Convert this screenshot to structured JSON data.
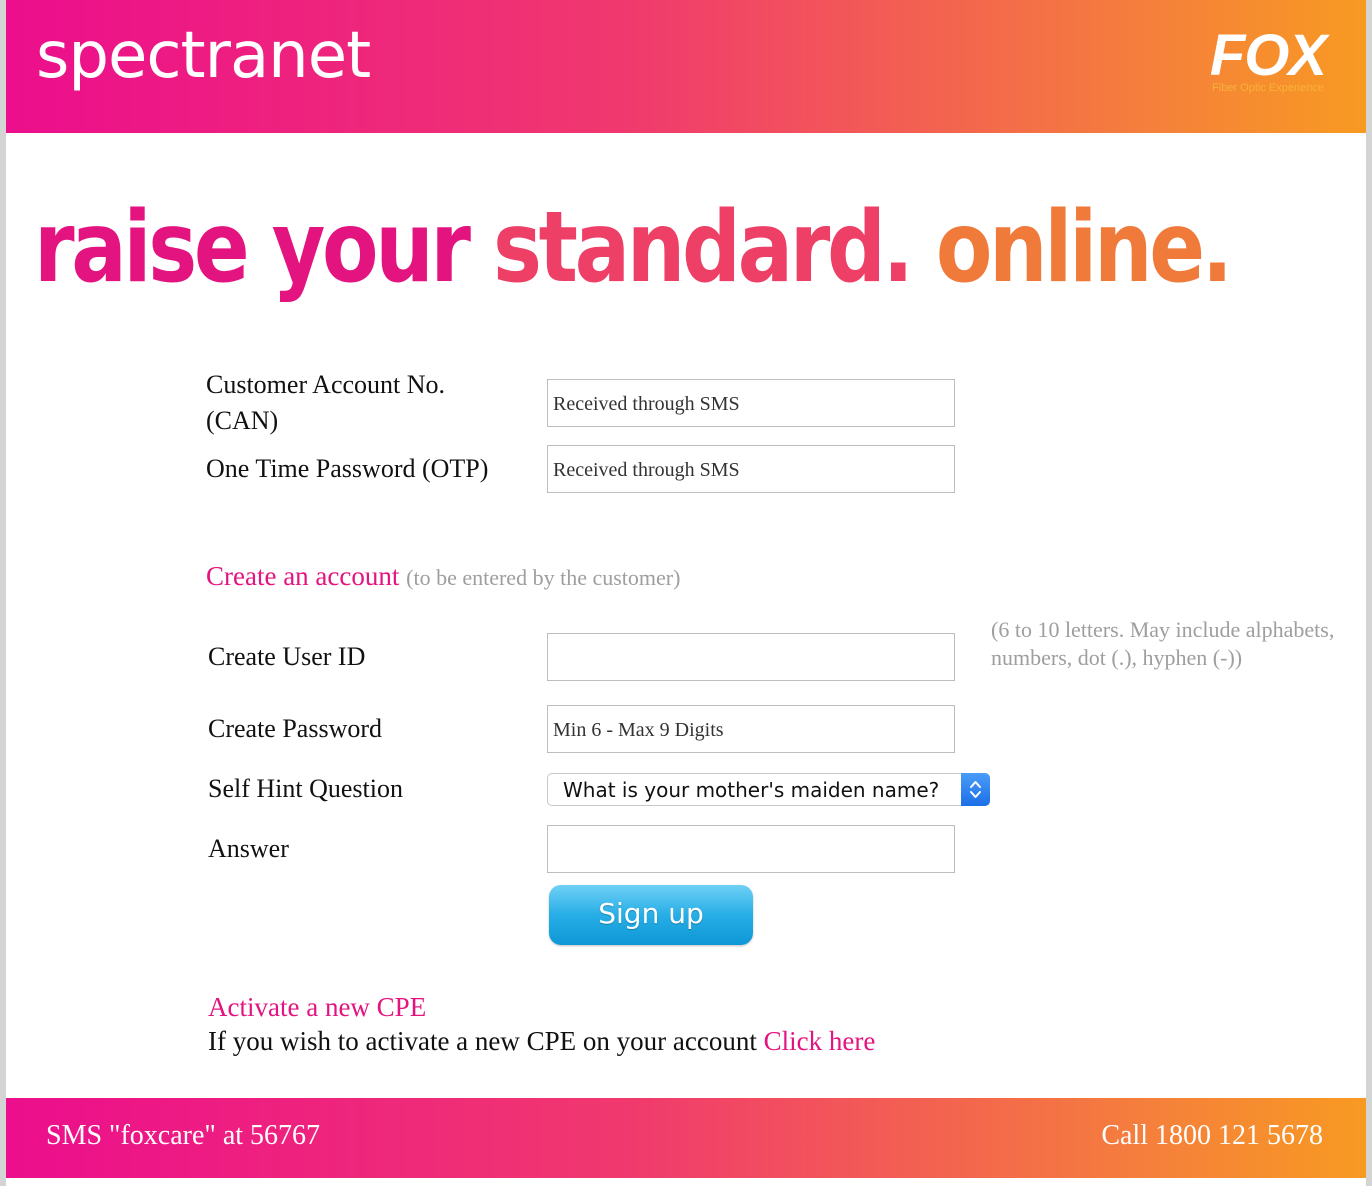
{
  "header": {
    "brand": "spectranet",
    "fox_logo": "FOX",
    "fox_tagline": "Fiber Optic Experience"
  },
  "banner": {
    "part1": "raise your ",
    "part2": "standard. ",
    "part3": "online."
  },
  "form": {
    "can_label_line1": "Customer Account No.",
    "can_label_line2": "(CAN)",
    "can_value": "Received through SMS",
    "otp_label": "One Time Password (OTP)",
    "otp_value": "Received through SMS",
    "section_title": "Create an account",
    "section_subtitle": "(to be entered by the customer)",
    "userid_label": "Create User ID",
    "userid_value": "",
    "userid_hint": "(6 to 10 letters. May include alphabets, numbers, dot (.), hyphen (-))",
    "password_label": "Create Password",
    "password_value": "Min 6 - Max 9 Digits",
    "hint_question_label": "Self Hint Question",
    "hint_question_selected": "What is your mother's maiden name?",
    "answer_label": "Answer",
    "answer_value": "",
    "signup_label": "Sign up"
  },
  "cpe": {
    "title": "Activate a new CPE",
    "text": "If you wish to activate a new CPE on your account ",
    "link": "Click here"
  },
  "footer": {
    "sms": "SMS \"foxcare\" at 56767",
    "call": "Call 1800 121 5678"
  },
  "colors": {
    "brand_pink": "#ec0e8c",
    "brand_orange": "#f89a22",
    "button_blue": "#27aee6"
  }
}
